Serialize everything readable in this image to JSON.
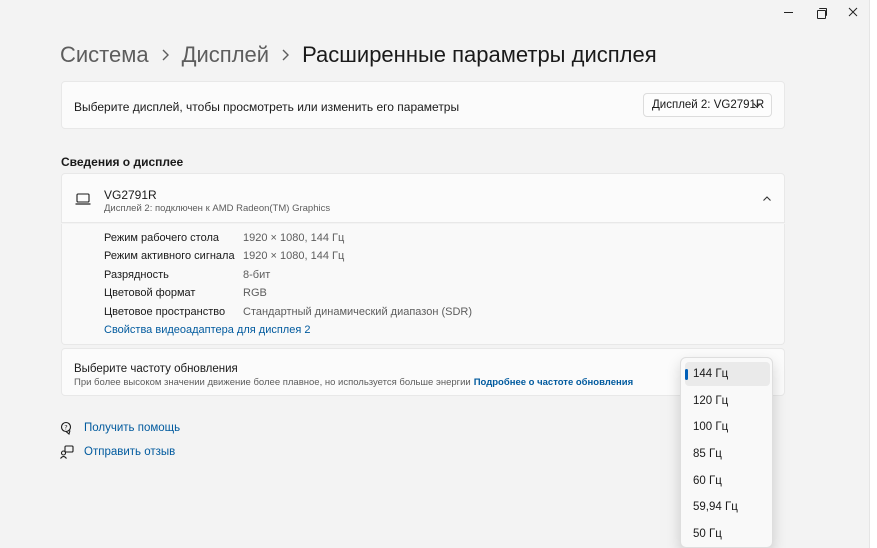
{
  "window": {
    "minimize_glyph": "—",
    "restore_glyph": "restore",
    "close_glyph": "✕"
  },
  "breadcrumb": {
    "items": [
      "Система",
      "Дисплей"
    ],
    "current": "Расширенные параметры дисплея"
  },
  "display_select": {
    "label": "Выберите дисплей, чтобы просмотреть или изменить его параметры",
    "value": "Дисплей 2: VG2791R"
  },
  "info_section": {
    "title": "Сведения о дисплее",
    "monitor_name": "VG2791R",
    "monitor_sub": "Дисплей 2: подключен к AMD Radeon(TM) Graphics",
    "properties": [
      {
        "key": "Режим рабочего стола",
        "value": "1920 × 1080, 144 Гц"
      },
      {
        "key": "Режим активного сигнала",
        "value": "1920 × 1080, 144 Гц"
      },
      {
        "key": "Разрядность",
        "value": "8-бит"
      },
      {
        "key": "Цветовой формат",
        "value": "RGB"
      },
      {
        "key": "Цветовое пространство",
        "value": "Стандартный динамический диапазон (SDR)"
      }
    ],
    "adapter_link": "Свойства видеоадаптера для дисплея 2"
  },
  "refresh": {
    "title": "Выберите частоту обновления",
    "description": "При более высоком значении движение более плавное, но используется больше энергии",
    "link": "Подробнее о частоте обновления",
    "options": [
      "144 Гц",
      "120 Гц",
      "100 Гц",
      "85 Гц",
      "60 Гц",
      "59,94 Гц",
      "50 Гц"
    ],
    "selected": "144 Гц"
  },
  "help": {
    "get_help": "Получить помощь",
    "feedback": "Отправить отзыв"
  },
  "colors": {
    "accent": "#005fb8",
    "link": "#005a9e",
    "background": "#f3f3f3",
    "card": "#fbfbfb"
  },
  "icons": {
    "monitor": "laptop-monitor-icon",
    "help": "help-icon",
    "feedback": "feedback-icon",
    "dropdown": "chevron-down-icon",
    "collapse": "chevron-up-icon",
    "breadcrumb_sep": "chevron-right-icon"
  }
}
